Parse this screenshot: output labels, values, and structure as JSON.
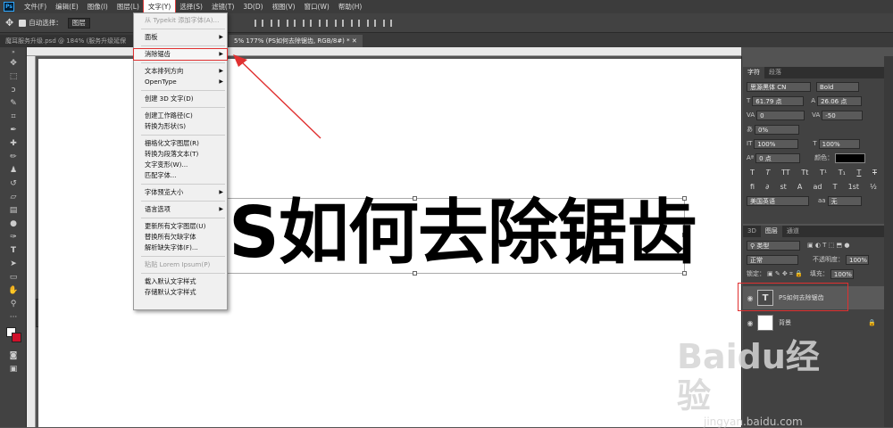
{
  "menubar": {
    "logo": "Ps",
    "items": [
      "文件(F)",
      "编辑(E)",
      "图像(I)",
      "图层(L)",
      "文字(Y)",
      "选择(S)",
      "滤镜(T)",
      "3D(D)",
      "视图(V)",
      "窗口(W)",
      "帮助(H)"
    ]
  },
  "options": {
    "autoselect_label": "自动选择：",
    "autoselect_value": "图层",
    "show_label": "显"
  },
  "tabs": {
    "tab1": "魔耳服务升级.psd @ 184% (服务升级延保",
    "tab2": "5% 177% (PS如何去除锯齿, RGB/8#) *"
  },
  "menu": {
    "items": [
      {
        "label": "从 Typekit 添加字体(A)...",
        "disabled": true
      },
      {
        "sep": true
      },
      {
        "label": "面板",
        "arrow": true
      },
      {
        "sep": true
      },
      {
        "label": "消除锯齿",
        "arrow": true,
        "highlight": true
      },
      {
        "sep": true
      },
      {
        "label": "文本排列方向",
        "arrow": true
      },
      {
        "label": "OpenType",
        "arrow": true
      },
      {
        "sep": true
      },
      {
        "label": "创建 3D 文字(D)"
      },
      {
        "sep": true
      },
      {
        "label": "创建工作路径(C)"
      },
      {
        "label": "转换为形状(S)"
      },
      {
        "sep": true
      },
      {
        "label": "栅格化文字图层(R)"
      },
      {
        "label": "转换为段落文本(T)"
      },
      {
        "label": "文字变形(W)..."
      },
      {
        "label": "匹配字体..."
      },
      {
        "sep": true
      },
      {
        "label": "字体预览大小",
        "arrow": true
      },
      {
        "sep": true
      },
      {
        "label": "语言选项",
        "arrow": true
      },
      {
        "sep": true
      },
      {
        "label": "更新所有文字图层(U)"
      },
      {
        "label": "替换所有欠缺字体"
      },
      {
        "label": "解析缺失字体(F)..."
      },
      {
        "sep": true
      },
      {
        "label": "粘贴 Lorem Ipsum(P)",
        "disabled": true
      },
      {
        "sep": true
      },
      {
        "label": "载入默认文字样式"
      },
      {
        "label": "存储默认文字样式"
      }
    ]
  },
  "canvas": {
    "text": "S如何去除锯齿"
  },
  "character": {
    "tab_char": "字符",
    "tab_para": "段落",
    "font_family": "思源黑体 CN",
    "font_style": "Bold",
    "size": "61.79 点",
    "leading": "26.06 点",
    "kerning": "0",
    "tracking": "-50",
    "scale_pct": "0%",
    "vscale": "100%",
    "hscale": "100%",
    "baseline": "0 点",
    "color_label": "颜色：",
    "language": "美国英语",
    "aa_prefix": "aa",
    "aa": "无"
  },
  "layers": {
    "tab_3d": "3D",
    "tab_layers": "图层",
    "tab_channels": "通道",
    "filter": "类型",
    "blend": "正常",
    "opacity_label": "不透明度：",
    "opacity": "100%",
    "lock_label": "锁定：",
    "fill_label": "填充：",
    "fill": "100%",
    "rows": [
      {
        "name": "PS如何去除锯齿",
        "thumb": "T"
      },
      {
        "name": "背景",
        "thumb": ""
      }
    ]
  },
  "watermark": {
    "brand": "Baidu经验",
    "url": "jingyan.baidu.com"
  }
}
